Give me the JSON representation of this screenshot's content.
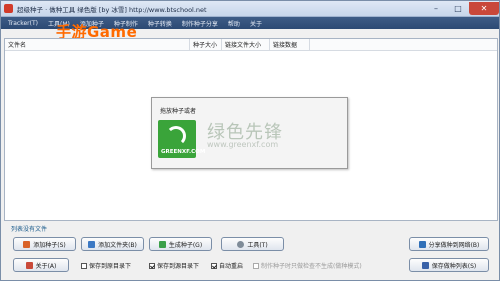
{
  "window": {
    "title": "超级种子 · 做种工具 绿色版 [by 冰雪] http://www.btschool.net"
  },
  "watermark": {
    "top": "手游Game",
    "center_cn": "绿色先锋",
    "center_url": "www.greenxf.com",
    "logo_text": "GREENXF.COM"
  },
  "menubar": {
    "items": [
      "Tracker(T)",
      "工具(M)",
      "添加种子",
      "种子制作",
      "种子转换",
      "制作种子分享",
      "帮助",
      "关于"
    ]
  },
  "list": {
    "columns": [
      "文件名",
      "种子大小",
      "链接文件大小",
      "链接数据"
    ]
  },
  "dialog": {
    "text": "拖放种子或者"
  },
  "status": {
    "text": "列表没有文件"
  },
  "buttons": {
    "add_torrent": "添加种子(S)",
    "add_folder": "添加文件夹(B)",
    "make_torrent": "生成种子(G)",
    "tools": "工具(T)",
    "share": "分享做种到网络(B)",
    "about": "关于(A)",
    "save": "保存做种列表(S)"
  },
  "options": [
    {
      "label": "保存到原目录下",
      "checked": false,
      "enabled": true
    },
    {
      "label": "保存到源目录下",
      "checked": true,
      "enabled": true
    },
    {
      "label": "自动重启",
      "checked": true,
      "enabled": true
    },
    {
      "label": "制作种子时只做检查不生成(做种模式)",
      "checked": false,
      "enabled": false
    }
  ],
  "colors": {
    "titlebar": "#c7d6ea",
    "menubar": "#2c4a74",
    "close_button": "#c9483a",
    "logo": "#3aa43a",
    "watermark": "#ff6a00"
  }
}
